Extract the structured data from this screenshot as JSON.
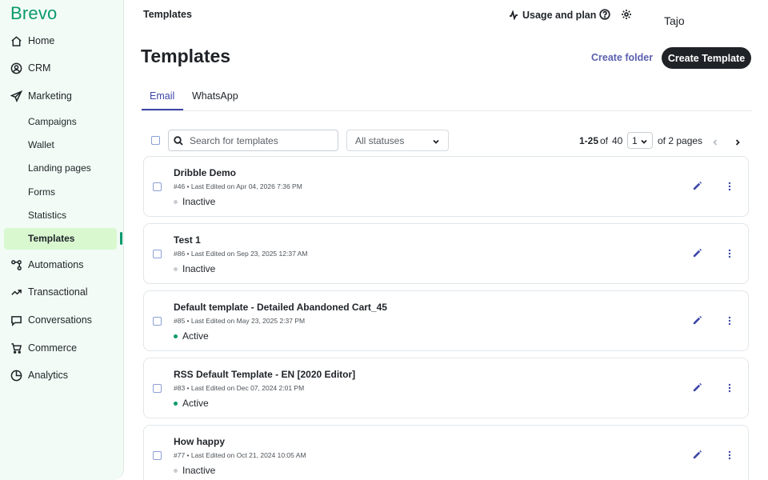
{
  "app": {
    "logo": "Brevo",
    "brand_color": "#0b996e",
    "accent_color": "#3d47a8"
  },
  "sidebar": {
    "items": [
      {
        "label": "Home",
        "icon": "home-icon"
      },
      {
        "label": "CRM",
        "icon": "contacts-icon"
      },
      {
        "label": "Marketing",
        "icon": "send-icon"
      }
    ],
    "marketing_sub": [
      {
        "label": "Campaigns"
      },
      {
        "label": "Wallet"
      },
      {
        "label": "Landing pages"
      },
      {
        "label": "Forms"
      },
      {
        "label": "Statistics"
      },
      {
        "label": "Templates",
        "active": true
      }
    ],
    "items_after": [
      {
        "label": "Automations",
        "icon": "automation-icon"
      },
      {
        "label": "Transactional",
        "icon": "transactional-icon"
      },
      {
        "label": "Conversations",
        "icon": "chat-icon"
      },
      {
        "label": "Commerce",
        "icon": "cart-icon"
      },
      {
        "label": "Analytics",
        "icon": "analytics-icon"
      }
    ]
  },
  "topbar": {
    "breadcrumb": "Templates",
    "usage_label": "Usage and plan",
    "help_icon": "help-icon",
    "settings_icon": "gear-icon",
    "user": "Tajo"
  },
  "header": {
    "title": "Templates",
    "create_folder": "Create folder",
    "create_template": "Create Template"
  },
  "tabs": [
    {
      "label": "Email",
      "active": true
    },
    {
      "label": "WhatsApp",
      "active": false
    }
  ],
  "toolbar": {
    "search_placeholder": "Search for templates",
    "status_filter": "All statuses",
    "range": "1-25",
    "of_label": "of",
    "total": "40",
    "page": "1",
    "pages_label": "of 2 pages"
  },
  "templates": [
    {
      "title": "Dribble Demo",
      "meta": "#46 • Last Edited on Apr 04, 2026 7:36 PM",
      "status": "Inactive",
      "status_color": "#c9cdd1"
    },
    {
      "title": "Test 1",
      "meta": "#86 • Last Edited on Sep 23, 2025 12:37 AM",
      "status": "Inactive",
      "status_color": "#c9cdd1"
    },
    {
      "title": "Default template - Detailed Abandoned Cart_45",
      "meta": "#85 • Last Edited on May 23, 2025 2:37 PM",
      "status": "Active",
      "status_color": "#0b996e"
    },
    {
      "title": "RSS Default Template - EN [2020 Editor]",
      "meta": "#83 • Last Edited on Dec 07, 2024 2:01 PM",
      "status": "Active",
      "status_color": "#0b996e"
    },
    {
      "title": "How happy",
      "meta": "#77 • Last Edited on Oct 21, 2024 10:05 AM",
      "status": "Inactive",
      "status_color": "#c9cdd1"
    }
  ]
}
